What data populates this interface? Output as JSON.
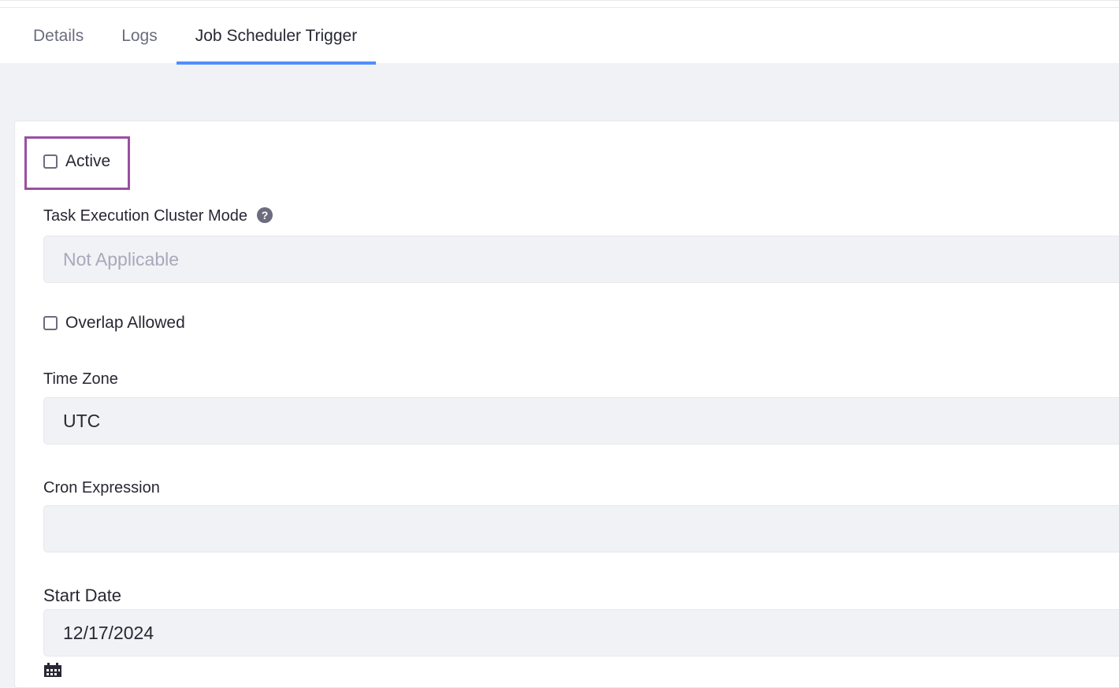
{
  "tabs": [
    {
      "label": "Details",
      "active": false
    },
    {
      "label": "Logs",
      "active": false
    },
    {
      "label": "Job Scheduler Trigger",
      "active": true
    }
  ],
  "form": {
    "active_label": "Active",
    "active_checked": false,
    "cluster_mode_label": "Task Execution Cluster Mode",
    "cluster_mode_help": "?",
    "cluster_mode_value": "Not Applicable",
    "overlap_label": "Overlap Allowed",
    "overlap_checked": false,
    "timezone_label": "Time Zone",
    "timezone_value": "UTC",
    "cron_label": "Cron Expression",
    "cron_value": "",
    "start_date_label": "Start Date",
    "start_date_value": "12/17/2024"
  },
  "colors": {
    "tab_active_underline": "#528eff",
    "highlight_border": "#9b4fa2"
  }
}
